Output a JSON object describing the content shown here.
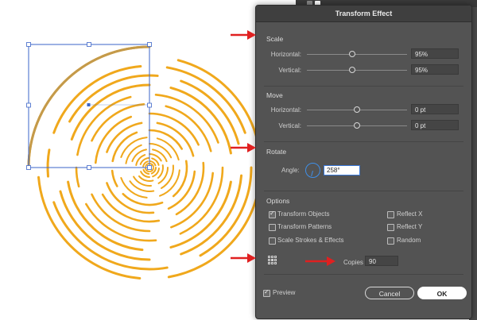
{
  "dialog": {
    "title": "Transform Effect",
    "scale": {
      "title": "Scale",
      "horizontal_label": "Horizontal:",
      "horizontal_value": "95%",
      "horizontal_slider": 0.45,
      "vertical_label": "Vertical:",
      "vertical_value": "95%",
      "vertical_slider": 0.45
    },
    "move": {
      "title": "Move",
      "horizontal_label": "Horizontal:",
      "horizontal_value": "0 pt",
      "horizontal_slider": 0.5,
      "vertical_label": "Vertical:",
      "vertical_value": "0 pt",
      "vertical_slider": 0.5
    },
    "rotate": {
      "title": "Rotate",
      "angle_label": "Angle:",
      "angle_value": "258°"
    },
    "options": {
      "title": "Options",
      "transform_objects": {
        "label": "Transform Objects",
        "checked": true
      },
      "transform_patterns": {
        "label": "Transform Patterns",
        "checked": false
      },
      "scale_strokes": {
        "label": "Scale Strokes & Effects",
        "checked": false
      },
      "reflect_x": {
        "label": "Reflect X",
        "checked": false
      },
      "reflect_y": {
        "label": "Reflect Y",
        "checked": false
      },
      "random": {
        "label": "Random",
        "checked": false
      }
    },
    "copies_label": "Copies",
    "copies_value": "90",
    "preview": {
      "label": "Preview",
      "checked": true
    },
    "cancel_label": "Cancel",
    "ok_label": "OK"
  },
  "colors": {
    "spiral": "#f0a81c",
    "selection": "#3b64c8",
    "arrow": "#e02020",
    "dialog_bg": "#535353"
  },
  "icons": [
    "reference-point-icon",
    "angle-dial-icon",
    "checkbox-check-icon"
  ]
}
